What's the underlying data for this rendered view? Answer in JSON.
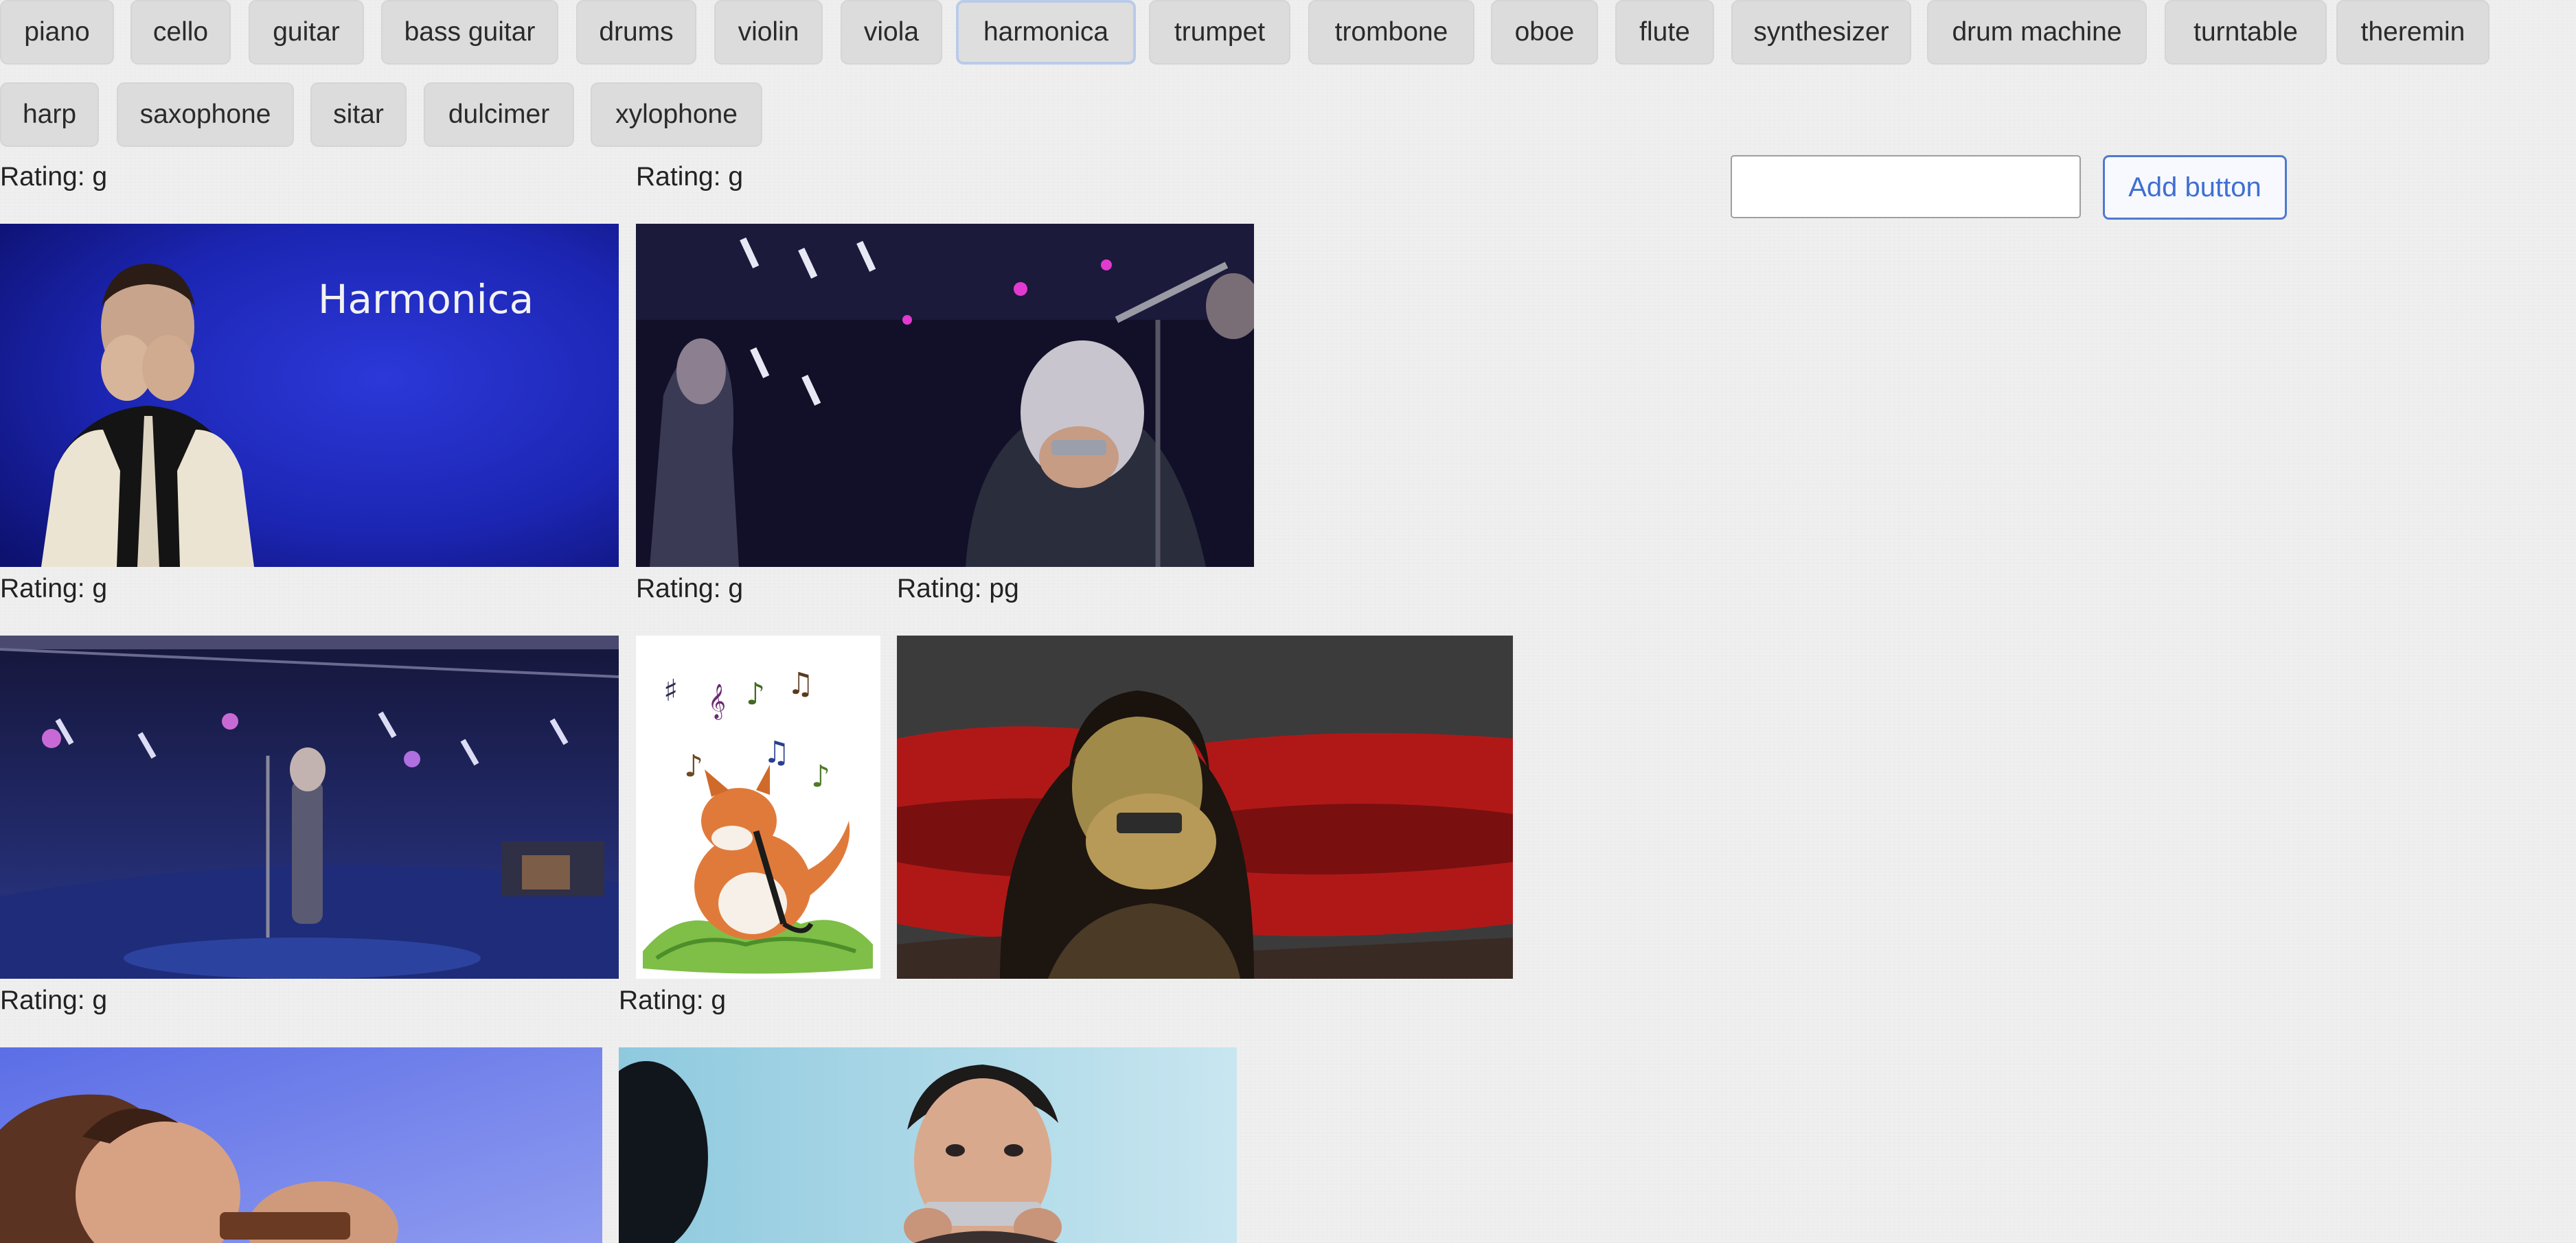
{
  "instrument_buttons": [
    {
      "label": "piano",
      "active": false
    },
    {
      "label": "cello",
      "active": false
    },
    {
      "label": "guitar",
      "active": false
    },
    {
      "label": "bass guitar",
      "active": false
    },
    {
      "label": "drums",
      "active": false
    },
    {
      "label": "violin",
      "active": false
    },
    {
      "label": "viola",
      "active": false
    },
    {
      "label": "harmonica",
      "active": true
    },
    {
      "label": "trumpet",
      "active": false
    },
    {
      "label": "trombone",
      "active": false
    },
    {
      "label": "oboe",
      "active": false
    },
    {
      "label": "flute",
      "active": false
    },
    {
      "label": "synthesizer",
      "active": false
    },
    {
      "label": "drum machine",
      "active": false
    },
    {
      "label": "turntable",
      "active": false
    },
    {
      "label": "theremin",
      "active": false
    },
    {
      "label": "harp",
      "active": false
    },
    {
      "label": "saxophone",
      "active": false
    },
    {
      "label": "sitar",
      "active": false
    },
    {
      "label": "dulcimer",
      "active": false
    },
    {
      "label": "xylophone",
      "active": false
    }
  ],
  "add_form": {
    "input_value": "",
    "input_placeholder": "",
    "button_label": "Add button"
  },
  "gifs": [
    {
      "rating": "Rating: g",
      "overlay_text": "Harmonica"
    },
    {
      "rating": "Rating: g"
    },
    {
      "rating": "Rating: g"
    },
    {
      "rating": "Rating: g"
    },
    {
      "rating": "Rating: pg"
    },
    {
      "rating": "Rating: g"
    },
    {
      "rating": "Rating: g"
    }
  ],
  "colors": {
    "accent": "#4f79cf",
    "active_button_border": "#b9cbe9",
    "button_bg": "#dcdcdc",
    "page_bg": "#efefef"
  }
}
